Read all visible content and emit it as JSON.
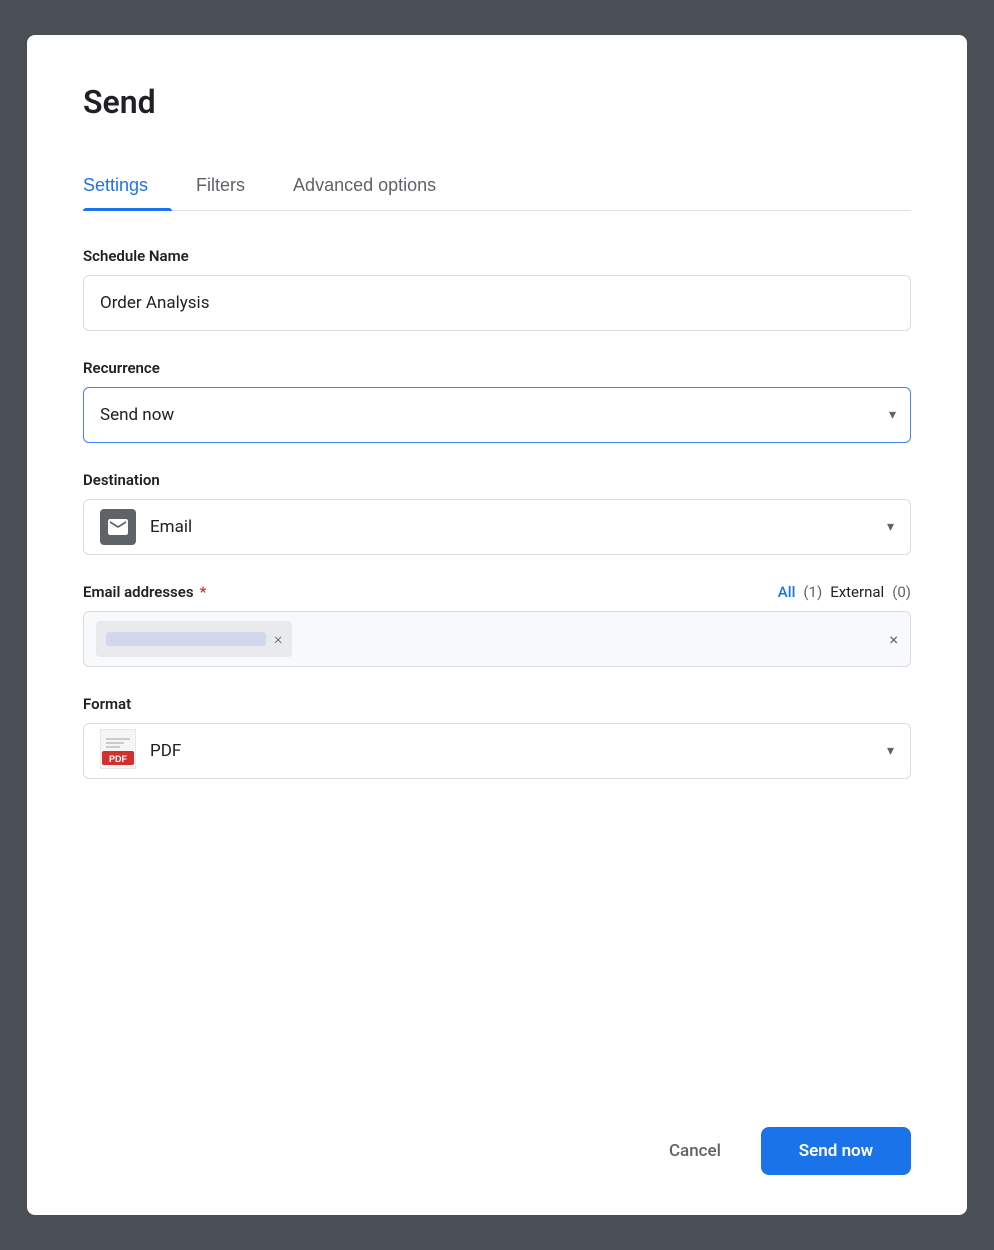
{
  "dialog": {
    "title": "Send"
  },
  "tabs": [
    {
      "id": "settings",
      "label": "Settings",
      "active": true
    },
    {
      "id": "filters",
      "label": "Filters",
      "active": false
    },
    {
      "id": "advanced",
      "label": "Advanced options",
      "active": false
    }
  ],
  "form": {
    "schedule_name_label": "Schedule Name",
    "schedule_name_value": "Order Analysis",
    "recurrence_label": "Recurrence",
    "recurrence_value": "Send now",
    "destination_label": "Destination",
    "destination_value": "Email",
    "email_addresses_label": "Email addresses",
    "email_all_label": "All",
    "email_all_count": "(1)",
    "email_external_label": "External",
    "email_external_count": "(0)",
    "format_label": "Format",
    "format_value": "PDF"
  },
  "footer": {
    "cancel_label": "Cancel",
    "send_label": "Send now"
  },
  "icons": {
    "chevron_down": "▾",
    "close": "×",
    "email": "email-icon",
    "pdf": "pdf-icon"
  }
}
